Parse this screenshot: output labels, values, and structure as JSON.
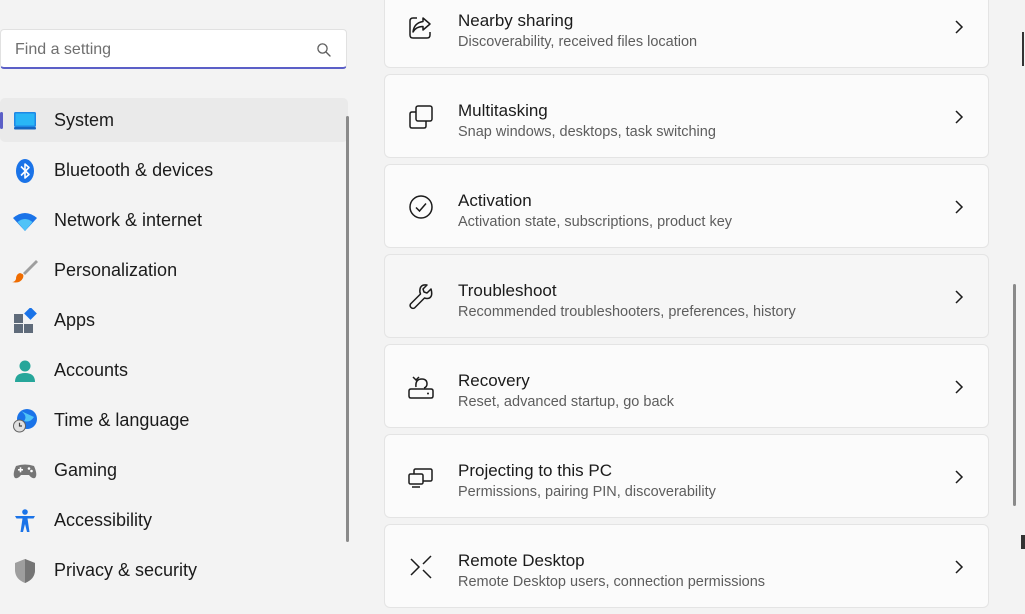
{
  "search": {
    "placeholder": "Find a setting",
    "icon": "search-icon"
  },
  "sidebar": {
    "items": [
      {
        "label": "System",
        "icon": "system-display-icon",
        "selected": true
      },
      {
        "label": "Bluetooth & devices",
        "icon": "bluetooth-icon"
      },
      {
        "label": "Network & internet",
        "icon": "wifi-icon"
      },
      {
        "label": "Personalization",
        "icon": "brush-icon"
      },
      {
        "label": "Apps",
        "icon": "apps-icon"
      },
      {
        "label": "Accounts",
        "icon": "person-icon"
      },
      {
        "label": "Time & language",
        "icon": "globe-clock-icon"
      },
      {
        "label": "Gaming",
        "icon": "gamepad-icon"
      },
      {
        "label": "Accessibility",
        "icon": "accessibility-icon"
      },
      {
        "label": "Privacy & security",
        "icon": "shield-icon"
      }
    ]
  },
  "main": {
    "cards": [
      {
        "title": "Nearby sharing",
        "subtitle": "Discoverability, received files location",
        "icon": "share-icon"
      },
      {
        "title": "Multitasking",
        "subtitle": "Snap windows, desktops, task switching",
        "icon": "multitasking-icon"
      },
      {
        "title": "Activation",
        "subtitle": "Activation state, subscriptions, product key",
        "icon": "check-circle-icon"
      },
      {
        "title": "Troubleshoot",
        "subtitle": "Recommended troubleshooters, preferences, history",
        "icon": "wrench-icon"
      },
      {
        "title": "Recovery",
        "subtitle": "Reset, advanced startup, go back",
        "icon": "recovery-icon"
      },
      {
        "title": "Projecting to this PC",
        "subtitle": "Permissions, pairing PIN, discoverability",
        "icon": "projecting-icon"
      },
      {
        "title": "Remote Desktop",
        "subtitle": "Remote Desktop users, connection permissions",
        "icon": "remote-desktop-icon"
      }
    ]
  },
  "colors": {
    "accent": "#5b5fc7",
    "background": "#f3f3f3",
    "card": "#fbfbfb"
  }
}
